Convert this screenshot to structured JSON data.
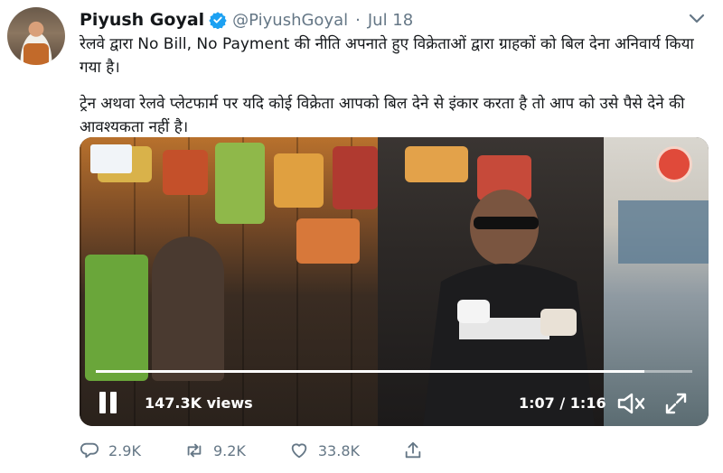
{
  "tweet": {
    "author_name": "Piyush Goyal",
    "handle": "@PiyushGoyal",
    "separator": "·",
    "date": "Jul 18",
    "text_paragraphs": [
      "रेलवे द्वारा No Bill, No Payment की नीति अपनाते हुए विक्रेताओं द्वारा ग्राहकों को बिल देना अनिवार्य किया गया है।",
      "ट्रेन अथवा रेलवे प्लेटफार्म पर यदि कोई विक्रेता आपको बिल देने से इंकार करता है तो आप को उसे पैसे देने की आवश्यकता नहीं है।"
    ]
  },
  "video": {
    "views": "147.3K views",
    "time": "1:07 / 1:16",
    "progress_fraction": 0.92,
    "state": "playing"
  },
  "actions": {
    "replies": "2.9K",
    "retweets": "9.2K",
    "likes": "33.8K"
  },
  "colors": {
    "verified_blue": "#1da1f2",
    "muted_text": "#657786",
    "primary_text": "#14171a"
  },
  "icons": [
    "verified-badge-icon",
    "caret-down-icon",
    "pause-icon",
    "volume-icon",
    "fullscreen-icon",
    "reply-icon",
    "retweet-icon",
    "like-icon",
    "share-icon"
  ]
}
